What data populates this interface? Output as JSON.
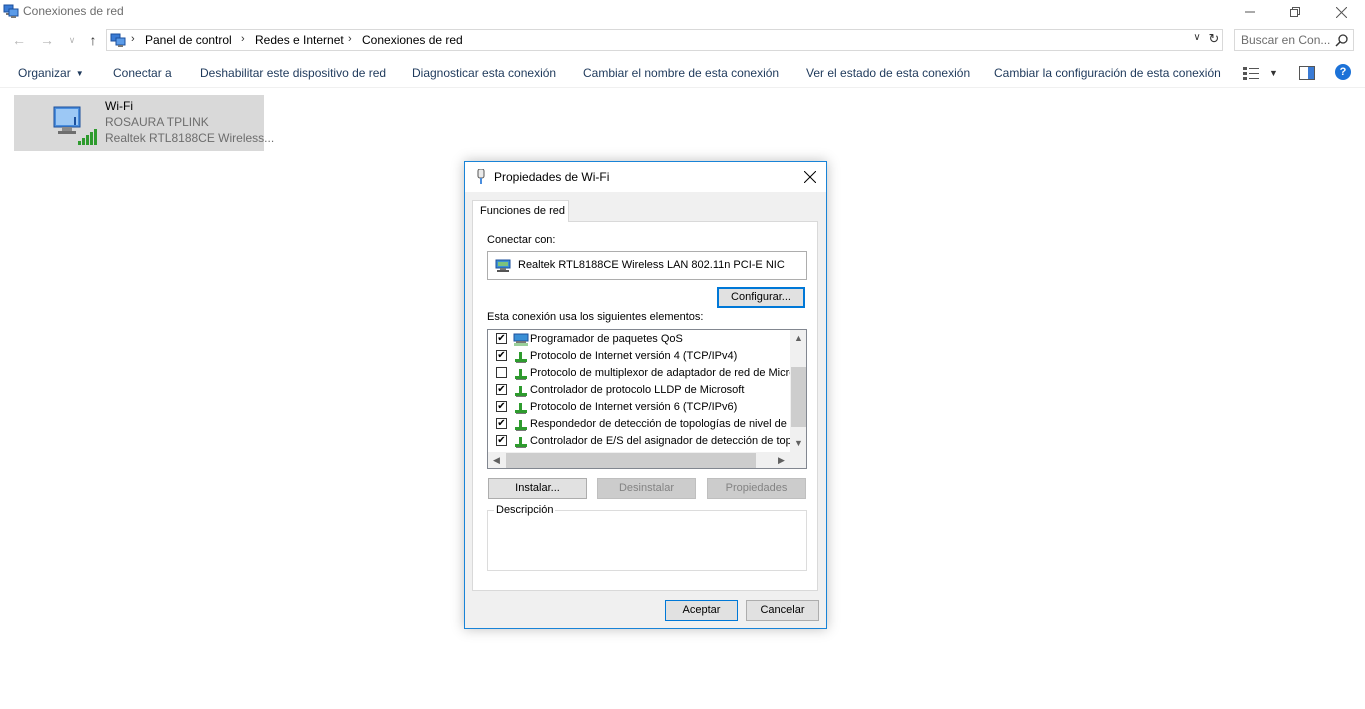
{
  "window": {
    "title": "Conexiones de red"
  },
  "address_bar": {
    "breadcrumbs": [
      "Panel de control",
      "Redes e Internet",
      "Conexiones de red"
    ]
  },
  "search": {
    "placeholder": "Buscar en Con..."
  },
  "command_bar": {
    "organize": "Organizar",
    "connect": "Conectar a",
    "disable": "Deshabilitar este dispositivo de red",
    "diagnose": "Diagnosticar esta conexión",
    "rename": "Cambiar el nombre de esta conexión",
    "status": "Ver el estado de esta conexión",
    "settings": "Cambiar la configuración de esta conexión",
    "help_icon": "?"
  },
  "connection": {
    "name": "Wi-Fi",
    "ssid": "ROSAURA TPLINK",
    "adapter": "Realtek RTL8188CE Wireless..."
  },
  "dialog": {
    "title": "Propiedades de Wi-Fi",
    "tab": "Funciones de red",
    "connect_using_label": "Conectar con:",
    "adapter_name": "Realtek RTL8188CE Wireless LAN 802.11n PCI-E NIC",
    "configure_button": "Configurar...",
    "items_label": "Esta conexión usa los siguientes elementos:",
    "items": [
      {
        "label": "Programador de paquetes QoS",
        "checked": true,
        "icon": "qos-icon"
      },
      {
        "label": "Protocolo de Internet versión 4 (TCP/IPv4)",
        "checked": true,
        "icon": "protocol-icon"
      },
      {
        "label": "Protocolo de multiplexor de adaptador de red de Micros",
        "checked": false,
        "icon": "protocol-icon"
      },
      {
        "label": "Controlador de protocolo LLDP de Microsoft",
        "checked": true,
        "icon": "protocol-icon"
      },
      {
        "label": "Protocolo de Internet versión 6 (TCP/IPv6)",
        "checked": true,
        "icon": "protocol-icon"
      },
      {
        "label": "Respondedor de detección de topologías de nivel de v",
        "checked": true,
        "icon": "protocol-icon"
      },
      {
        "label": "Controlador de E/S del asignador de detección de topo",
        "checked": true,
        "icon": "protocol-icon"
      }
    ],
    "install_button": "Instalar...",
    "uninstall_button": "Desinstalar",
    "properties_button": "Propiedades",
    "description_label": "Descripción",
    "ok_button": "Aceptar",
    "cancel_button": "Cancelar"
  }
}
